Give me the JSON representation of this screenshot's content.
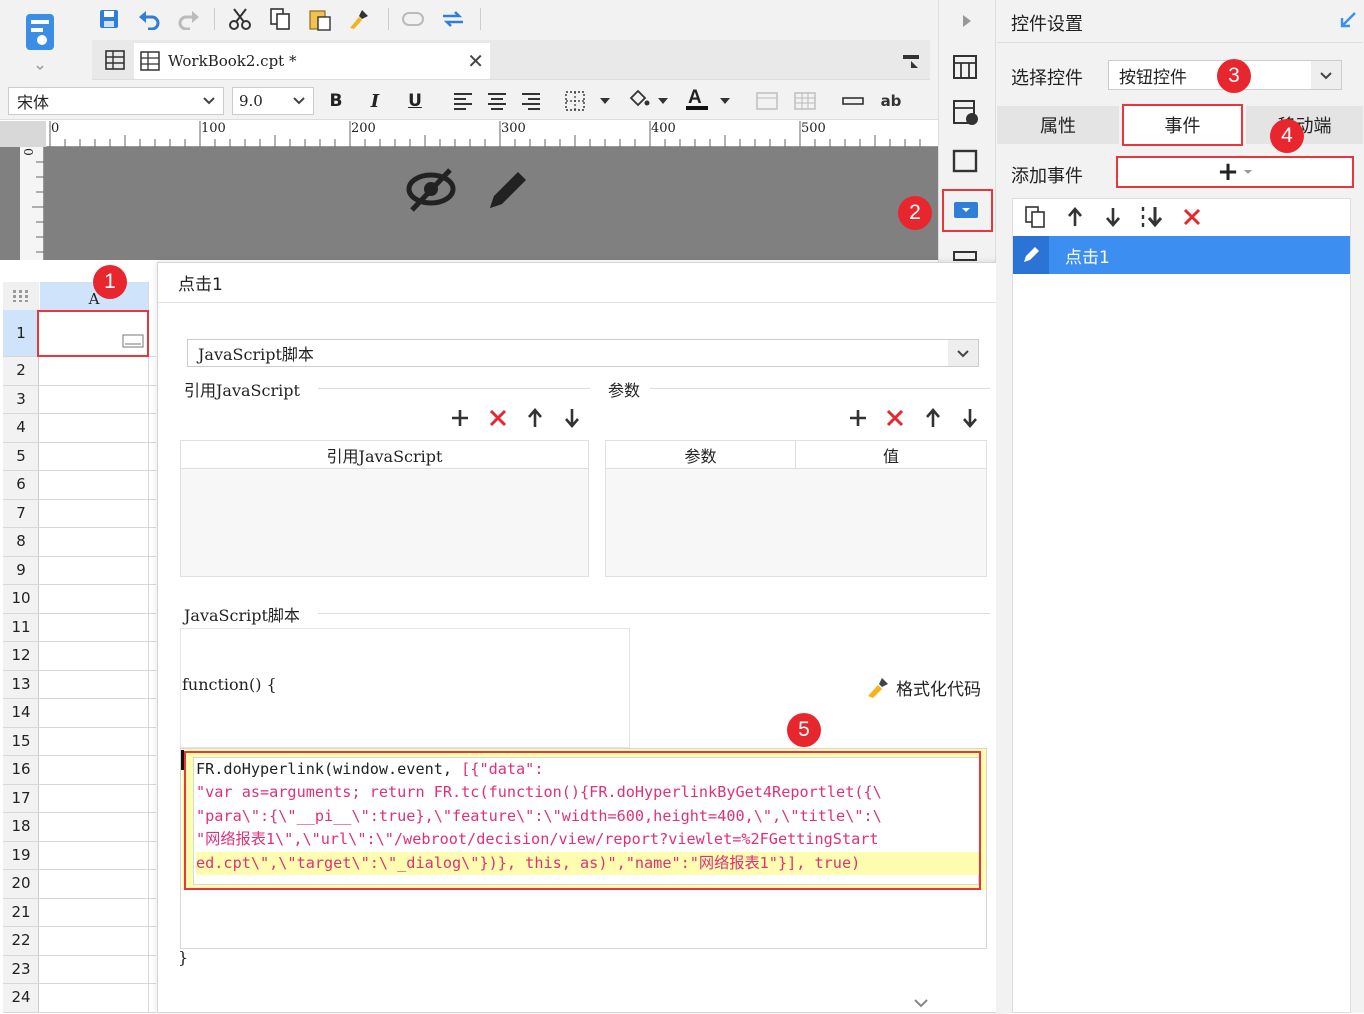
{
  "toolbar": {
    "file_tab": "WorkBook2.cpt *",
    "font_name": "宋体",
    "font_size": "9.0",
    "bold": "B",
    "italic": "I",
    "underline": "U",
    "ab": "ab"
  },
  "ruler": {
    "ticks": [
      "0",
      "100",
      "200",
      "300",
      "400",
      "500"
    ],
    "vertical_zero": "0"
  },
  "sheet": {
    "column_header": "A",
    "row_numbers": [
      "1",
      "2",
      "3",
      "4",
      "5",
      "6",
      "7",
      "8",
      "9",
      "10",
      "11",
      "12",
      "13",
      "14",
      "15",
      "16",
      "17",
      "18",
      "19",
      "20",
      "21",
      "22",
      "23",
      "24"
    ]
  },
  "dialog": {
    "title": "点击1",
    "type_select": "JavaScript脚本",
    "ref_js_section": "引用JavaScript",
    "ref_js_col": "引用JavaScript",
    "params_section": "参数",
    "params_col_name": "参数",
    "params_col_value": "值",
    "script_section": "JavaScript脚本",
    "fn_open": "function() {",
    "format_code": "格式化代码",
    "code_lines": [
      {
        "a": "FR.doHyperlink(window.event, ",
        "b": "[{\"data\":"
      },
      {
        "a": "",
        "b": "\"var as=arguments; return FR.tc(function(){FR.doHyperlinkByGet4Reportlet({\\"
      },
      {
        "a": "",
        "b": "\"para\\\":{\\\"__pi__\\\":true},\\\"feature\\\":\\\"width=600,height=400,\\\",\\\"title\\\":\\"
      },
      {
        "a": "",
        "b": "\"网络报表1\\\",\\\"url\\\":\\\"/webroot/decision/view/report?viewlet=%2FGettingStart"
      },
      {
        "a": "",
        "b": "ed.cpt\\\",\\\"target\\\":\\\"_dialog\\\"})}, this, as)\",\"name\":\"网络报表1\"}], true)"
      }
    ],
    "fn_close": "}"
  },
  "right_panel": {
    "title": "控件设置",
    "select_label": "选择控件",
    "select_value": "按钮控件",
    "tabs": [
      "属性",
      "事件",
      "移动端"
    ],
    "add_event_label": "添加事件",
    "add_button": "+",
    "event_item": "点击1"
  },
  "badges": [
    "1",
    "2",
    "3",
    "4",
    "5"
  ],
  "colors": {
    "accent": "#3c8ff0",
    "highlight": "#e8363f",
    "badge": "#e8262e",
    "code": "#e0307a"
  }
}
